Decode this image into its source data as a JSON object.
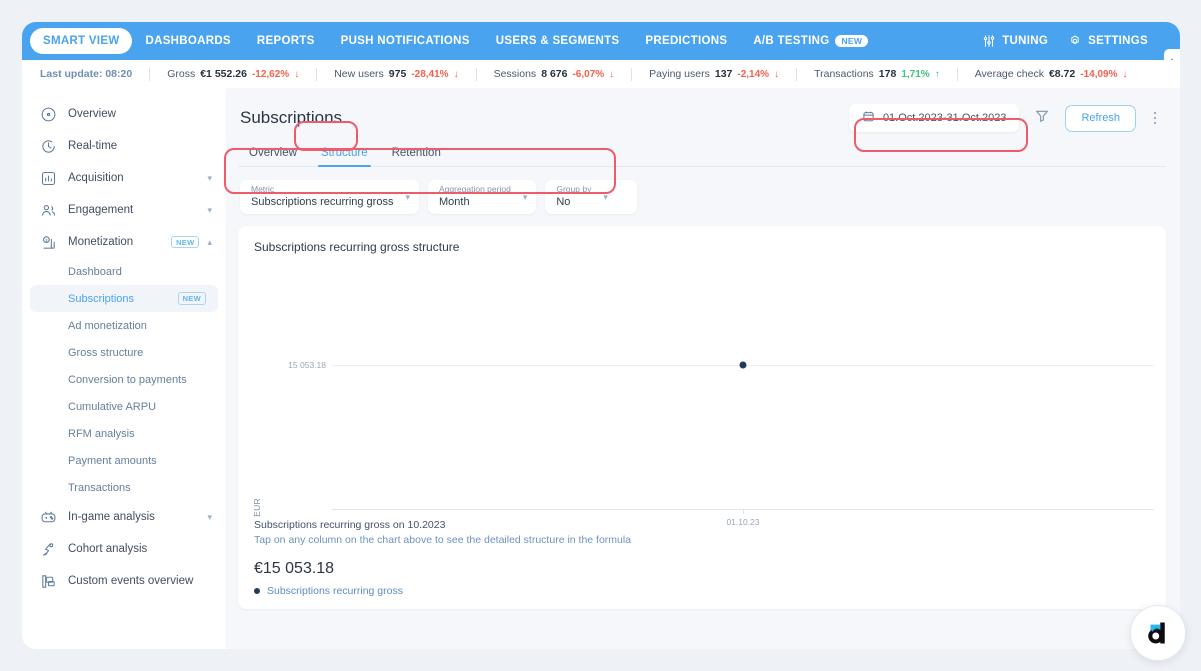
{
  "navbar": {
    "items": [
      {
        "label": "SMART VIEW",
        "active": true,
        "badge": null
      },
      {
        "label": "DASHBOARDS",
        "active": false,
        "badge": null
      },
      {
        "label": "REPORTS",
        "active": false,
        "badge": null
      },
      {
        "label": "PUSH NOTIFICATIONS",
        "active": false,
        "badge": null
      },
      {
        "label": "USERS & SEGMENTS",
        "active": false,
        "badge": null
      },
      {
        "label": "PREDICTIONS",
        "active": false,
        "badge": null
      },
      {
        "label": "A/B TESTING",
        "active": false,
        "badge": "NEW"
      }
    ],
    "right": [
      {
        "label": "TUNING",
        "icon": "sliders-icon"
      },
      {
        "label": "SETTINGS",
        "icon": "gear-icon"
      }
    ],
    "accent": "#4aa3ee"
  },
  "kpi_strip": {
    "last_update": "Last update: 08:20",
    "metrics": [
      {
        "label": "Gross",
        "value": "€1 552.26",
        "delta": "-12,62%",
        "dir": "down"
      },
      {
        "label": "New users",
        "value": "975",
        "delta": "-28,41%",
        "dir": "down"
      },
      {
        "label": "Sessions",
        "value": "8 676",
        "delta": "-6,07%",
        "dir": "down"
      },
      {
        "label": "Paying users",
        "value": "137",
        "delta": "-2,14%",
        "dir": "down"
      },
      {
        "label": "Transactions",
        "value": "178",
        "delta": "1,71%",
        "dir": "up"
      },
      {
        "label": "Average check",
        "value": "€8.72",
        "delta": "-14,09%",
        "dir": "down"
      }
    ],
    "color_down": "#f4604e",
    "color_up": "#3fc27b"
  },
  "sidebar": {
    "items": [
      {
        "label": "Overview",
        "icon": "overview-icon",
        "expandable": false,
        "badge": null
      },
      {
        "label": "Real-time",
        "icon": "clock-icon",
        "expandable": false,
        "badge": null
      },
      {
        "label": "Acquisition",
        "icon": "acquisition-chart-icon",
        "expandable": true,
        "expanded": false,
        "badge": null
      },
      {
        "label": "Engagement",
        "icon": "people-icon",
        "expandable": true,
        "expanded": false,
        "badge": null
      },
      {
        "label": "Monetization",
        "icon": "money-chart-icon",
        "expandable": true,
        "expanded": true,
        "badge": "NEW"
      }
    ],
    "monetization_children": [
      {
        "label": "Dashboard",
        "selected": false,
        "badge": null
      },
      {
        "label": "Subscriptions",
        "selected": true,
        "badge": "NEW"
      },
      {
        "label": "Ad monetization",
        "selected": false,
        "badge": null
      },
      {
        "label": "Gross structure",
        "selected": false,
        "badge": null
      },
      {
        "label": "Conversion to payments",
        "selected": false,
        "badge": null
      },
      {
        "label": "Cumulative ARPU",
        "selected": false,
        "badge": null
      },
      {
        "label": "RFM analysis",
        "selected": false,
        "badge": null
      },
      {
        "label": "Payment amounts",
        "selected": false,
        "badge": null
      },
      {
        "label": "Transactions",
        "selected": false,
        "badge": null
      }
    ],
    "items_tail": [
      {
        "label": "In-game analysis",
        "icon": "gamepad-icon",
        "expandable": true,
        "badge": null
      },
      {
        "label": "Cohort analysis",
        "icon": "cohort-icon",
        "expandable": false,
        "badge": null
      },
      {
        "label": "Custom events overview",
        "icon": "custom-events-icon",
        "expandable": false,
        "badge": null
      }
    ]
  },
  "page": {
    "title": "Subscriptions",
    "date_range": "01.Oct.2023-31.Oct.2023",
    "refresh_label": "Refresh"
  },
  "tabs": [
    {
      "label": "Overview",
      "active": false
    },
    {
      "label": "Structure",
      "active": true
    },
    {
      "label": "Retention",
      "active": false
    }
  ],
  "filters": [
    {
      "label": "Metric",
      "value": "Subscriptions recurring gross"
    },
    {
      "label": "Aggregation period",
      "value": "Month"
    },
    {
      "label": "Group by",
      "value": "No"
    }
  ],
  "chart_data": {
    "type": "scatter",
    "title": "Subscriptions recurring gross structure",
    "xlabel": "",
    "ylabel": "EUR",
    "categories": [
      "01.10.23"
    ],
    "x": [
      "01.10.23"
    ],
    "values": [
      15053.18
    ],
    "series": [
      {
        "name": "Subscriptions recurring gross",
        "values": [
          15053.18
        ],
        "color": "#1f3b5c"
      }
    ],
    "ytick_labels": [
      "15 053.18"
    ],
    "ytick_values": [
      15053.18
    ],
    "ylim": [
      0,
      15053.18
    ],
    "grid": true,
    "legend": [
      "Subscriptions recurring gross"
    ],
    "legend_position": "bottom-left",
    "point_color": "#1f3b5c"
  },
  "chart_footer": {
    "line1": "Subscriptions recurring gross on 10.2023",
    "line2": "Tap on any column on the chart above to see the detailed structure in the formula",
    "total": "€15 053.18",
    "legend_label": "Subscriptions recurring gross"
  },
  "chat_widget": {
    "label": "d"
  }
}
